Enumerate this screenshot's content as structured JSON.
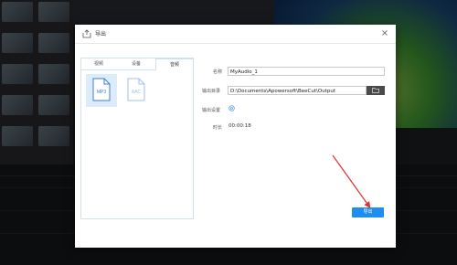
{
  "dialog": {
    "title": "导出",
    "close_glyph": "×",
    "tabs": [
      {
        "label": "视频",
        "active": false
      },
      {
        "label": "设备",
        "active": false
      },
      {
        "label": "音频",
        "active": true
      }
    ],
    "formats": [
      {
        "label": "MP3",
        "selected": true
      },
      {
        "label": "AAC",
        "selected": false
      }
    ],
    "fields": {
      "name_label": "名称",
      "name_value": "MyAudio_1",
      "output_dir_label": "输出目录",
      "output_dir_value": "D:\\Documents\\Apowersoft\\BeeCut\\Output",
      "output_settings_label": "输出设置",
      "duration_label": "时长",
      "duration_value": "00:00:18"
    },
    "export_button": "导出"
  },
  "colors": {
    "accent": "#1e8ef0",
    "arrow": "#e0322c",
    "tab_border": "#cfe0f0"
  }
}
